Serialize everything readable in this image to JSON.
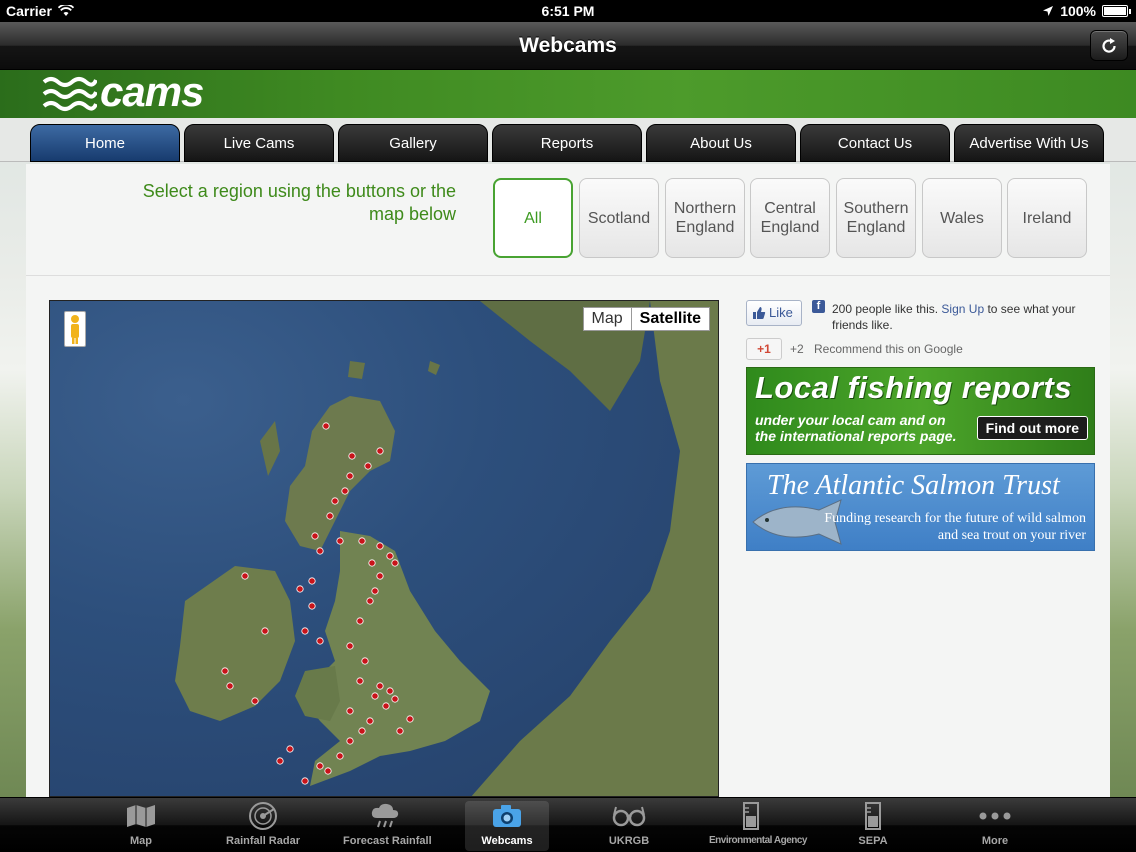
{
  "status_bar": {
    "carrier": "Carrier",
    "time": "6:51 PM",
    "battery": "100%"
  },
  "nav_bar": {
    "title": "Webcams"
  },
  "site": {
    "logo_text": "cams",
    "menu": [
      "Home",
      "Live Cams",
      "Gallery",
      "Reports",
      "About Us",
      "Contact Us",
      "Advertise With Us"
    ],
    "active_menu": "Home",
    "region_prompt": "Select a region using the buttons or the map below",
    "regions": [
      "All",
      "Scotland",
      "Northern England",
      "Central England",
      "Southern England",
      "Wales",
      "Ireland"
    ],
    "active_region": "All"
  },
  "map": {
    "toggle_map": "Map",
    "toggle_satellite": "Satellite",
    "selected": "Satellite"
  },
  "social": {
    "like_label": "Like",
    "fb_count_text": "200 people like this.",
    "fb_signup": "Sign Up",
    "fb_rest": "to see what your friends like.",
    "gplus_label": "+1",
    "gplus_count": "+2",
    "gplus_text": "Recommend this on Google"
  },
  "ads": {
    "fishing_headline": "Local fishing reports",
    "fishing_sub": "under your local cam and on the international reports page.",
    "fishing_cta": "Find out more",
    "salmon_headline": "The Atlantic Salmon Trust",
    "salmon_sub": "Funding research for the future of wild salmon and sea trout on your river"
  },
  "tab_bar": {
    "items": [
      {
        "label": "Map",
        "icon": "map-icon"
      },
      {
        "label": "Rainfall Radar",
        "icon": "radar-icon"
      },
      {
        "label": "Forecast Rainfall",
        "icon": "rain-cloud-icon"
      },
      {
        "label": "Webcams",
        "icon": "camera-icon"
      },
      {
        "label": "UKRGB",
        "icon": "glasses-icon"
      },
      {
        "label": "Environmental Agency",
        "icon": "gauge-icon"
      },
      {
        "label": "SEPA",
        "icon": "gauge-icon"
      },
      {
        "label": "More",
        "icon": "more-icon"
      }
    ],
    "active": "Webcams"
  },
  "colors": {
    "accent_green": "#3e8a1a",
    "active_tab_blue": "#2a5590",
    "marker_red": "#c8141a"
  }
}
